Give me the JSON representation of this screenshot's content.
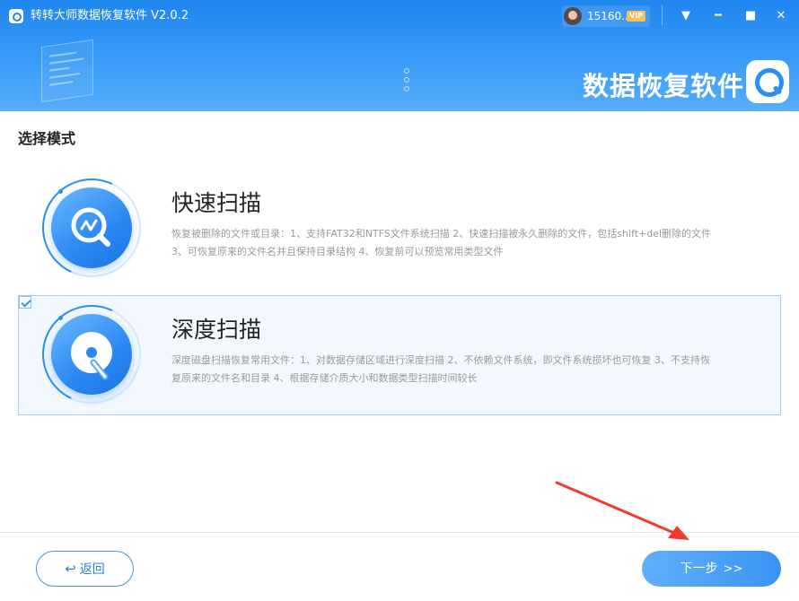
{
  "window": {
    "title": "转转大师数据恢复软件 V2.0.2",
    "user": {
      "id": "15160...",
      "badge": "VIP"
    },
    "controls": {
      "menu": "▼",
      "minimize": "━",
      "maximize": "■",
      "close": "✕"
    }
  },
  "banner": {
    "title": "数据恢复软件"
  },
  "page": {
    "section_title": "选择模式"
  },
  "modes": [
    {
      "title": "快速扫描",
      "description": "恢复被删除的文件或目录：1、支持FAT32和NTFS文件系统扫描 2、快速扫描被永久删除的文件，包括shift+del删除的文件 3、可恢复原来的文件名并且保持目录结构 4、恢复前可以预览常用类型文件",
      "selected": false,
      "icon": "chart-search-icon"
    },
    {
      "title": "深度扫描",
      "description": "深度磁盘扫描恢复常用文件：1、对数据存储区域进行深度扫描 2、不依赖文件系统，即文件系统损坏也可恢复 3、不支持恢复原来的文件名和目录 4、根据存储介质大小和数据类型扫描时间较长",
      "selected": true,
      "icon": "disk-scan-icon"
    }
  ],
  "footer": {
    "back_label": "返回",
    "back_icon": "↩",
    "next_label": "下一步",
    "next_arrows": ">>"
  },
  "colors": {
    "primary": "#2a8ff3",
    "selected_bg": "#f3f8ff",
    "selected_border": "#a8cdf4",
    "annotation_arrow": "#f03a2c"
  }
}
